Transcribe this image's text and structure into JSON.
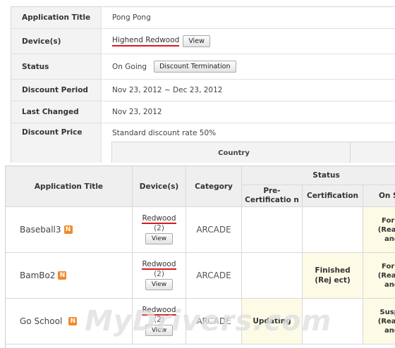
{
  "detail": {
    "rows": [
      {
        "label": "Application Title",
        "value": "Pong Pong"
      },
      {
        "label": "Device(s)",
        "device": "Highend Redwood",
        "button": "View"
      },
      {
        "label": "Status",
        "value": "On Going",
        "button": "Discount Termination"
      },
      {
        "label": "Discount Period",
        "value": "Nov 23, 2012 ~ Dec 23, 2012"
      },
      {
        "label": "Last Changed",
        "value": "Nov 23, 2012"
      },
      {
        "label": "Discount Price",
        "value": "Standard discount rate 50%"
      }
    ],
    "country_header": "Country"
  },
  "table": {
    "headers": {
      "title": "Application Title",
      "devices": "Device(s)",
      "category": "Category",
      "status": "Status",
      "pre_cert": "Pre-Certificatio n",
      "cert": "Certification",
      "on_sale": "On S"
    },
    "rows": [
      {
        "title": "Baseball3",
        "badge": "N",
        "device": "Redwood",
        "count": "(2)",
        "view": "View",
        "category": "ARCADE",
        "pre_cert": "",
        "cert": "",
        "on_sale": "For S (Ready ang"
      },
      {
        "title": "BamBo2",
        "badge": "N",
        "device": "Redwood",
        "count": "(2)",
        "view": "View",
        "category": "ARCADE",
        "pre_cert": "",
        "cert": "Finished (Rej ect)",
        "on_sale": "For S (Ready ang"
      },
      {
        "title": "Go School",
        "badge": "N",
        "device": "Redwood",
        "count": "(2)",
        "view": "View",
        "category": "ARCADE",
        "pre_cert": "Updating",
        "cert": "",
        "on_sale": "Suspe (Ready ang"
      }
    ]
  },
  "watermark": "MyDrivers.com",
  "colors": {
    "accent_underline": "#d81a1a",
    "badge": "#f08a2c",
    "highlight": "#fdfbe6",
    "header_bg": "#efefef"
  }
}
